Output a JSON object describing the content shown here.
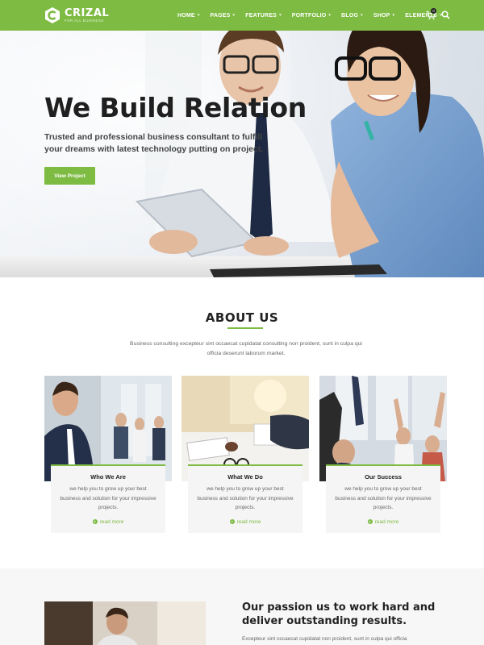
{
  "brand": {
    "name": "CRIZAL",
    "tagline": "FOR ALL BUSINESS"
  },
  "nav": {
    "items": [
      {
        "label": "HOME"
      },
      {
        "label": "PAGES"
      },
      {
        "label": "FEATURES"
      },
      {
        "label": "PORTFOLIO"
      },
      {
        "label": "BLOG"
      },
      {
        "label": "SHOP"
      },
      {
        "label": "ELEMENTS"
      }
    ],
    "cart_count": "0"
  },
  "hero": {
    "title": "We Build Relation",
    "subtitle": "Trusted and professional business consultant to fulfill your dreams with latest technology putting on project.",
    "button": "View Project"
  },
  "about": {
    "title": "ABOUT US",
    "description": "Business consulting excepteur sint occaecat cupidatat consulting non proident, sunt in culpa qui officia deserunt laborum market.",
    "cards": [
      {
        "title": "Who We Are",
        "text": "we help you to grow up your best business and solution for your impressive projects.",
        "link": "read more"
      },
      {
        "title": "What We Do",
        "text": "we help you to grow up your best business and solution for your impressive projects.",
        "link": "read more"
      },
      {
        "title": "Our Success",
        "text": "we help you to grow up your best business and solution for your impressive projects.",
        "link": "read more"
      }
    ]
  },
  "passion": {
    "title": "Our passion us to work hard and deliver outstanding results.",
    "text": "Excepteur sint occaecat cupidatat non proident, sunt in culpa qui officia"
  },
  "colors": {
    "accent": "#7dbb42",
    "text_dark": "#222222",
    "muted": "#666666"
  },
  "icons": [
    "logo-c-icon",
    "chevron-down-icon",
    "cart-icon",
    "search-icon",
    "arrow-circle-icon"
  ]
}
